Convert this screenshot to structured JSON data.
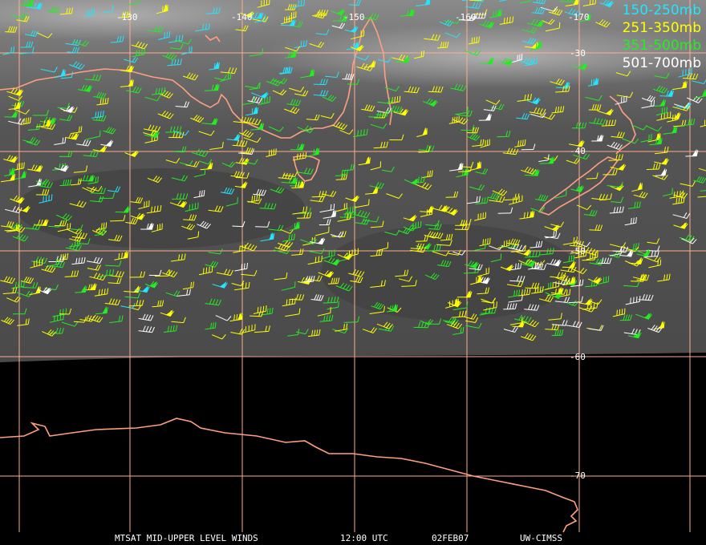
{
  "legend": [
    {
      "label": "150-250mb",
      "color": "#22e5ff"
    },
    {
      "label": "251-350mb",
      "color": "#ffff00"
    },
    {
      "label": "351-500mb",
      "color": "#22ee22"
    },
    {
      "label": "501-700mb",
      "color": "#ffffff"
    }
  ],
  "longitude_labels": [
    "-130",
    "-140",
    "-150",
    "-160",
    "-170"
  ],
  "latitude_labels": [
    "-30",
    "-40",
    "-50",
    "-60",
    "-70"
  ],
  "footer": {
    "product": "MTSAT MID-UPPER LEVEL WINDS",
    "time": "12:00 UTC",
    "date": "02FEB07",
    "source": "UW-CIMSS"
  },
  "colors": {
    "grid": "#ffae8c",
    "coastline": "#ff9f80",
    "background_imagery": "#5a5a5a",
    "space": "#000000"
  }
}
